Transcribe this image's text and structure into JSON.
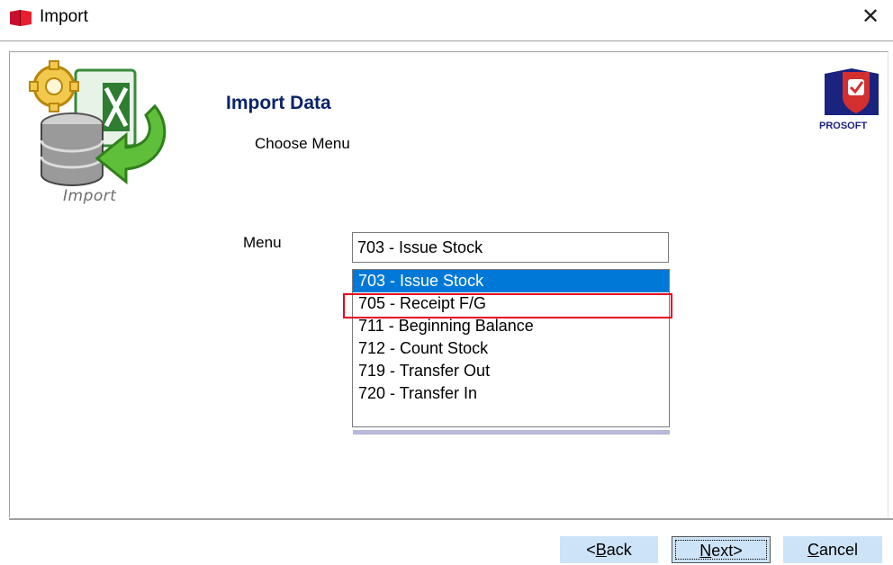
{
  "window": {
    "title": "Import",
    "close_glyph": "✕",
    "icon": "book-icon"
  },
  "left_logo": {
    "label": "Import",
    "icon": "import-database-icon"
  },
  "brand": {
    "name": "PROSOFT",
    "icon": "prosoft-shield-icon"
  },
  "main": {
    "heading": "Import Data",
    "subheading": "Choose Menu",
    "menu_label": "Menu",
    "selected_value": "703 - Issue Stock"
  },
  "dropdown": {
    "items": [
      {
        "label": "703 - Issue Stock",
        "selected": true
      },
      {
        "label": "705 - Receipt F/G",
        "highlighted": true
      },
      {
        "label": "711 - Beginning Balance"
      },
      {
        "label": "712 - Count Stock"
      },
      {
        "label": "719 - Transfer Out"
      },
      {
        "label": "720 - Transfer In"
      }
    ]
  },
  "buttons": {
    "back": {
      "accel": "B",
      "pre": "<",
      "rest": "ack"
    },
    "next": {
      "accel": "N",
      "rest": "ext>"
    },
    "cancel": {
      "accel": "C",
      "rest": "ancel"
    }
  },
  "colors": {
    "heading": "#0a246a",
    "selection": "#0078d7",
    "highlight_box": "#e8001c",
    "button_bg": "#cde3f7"
  }
}
